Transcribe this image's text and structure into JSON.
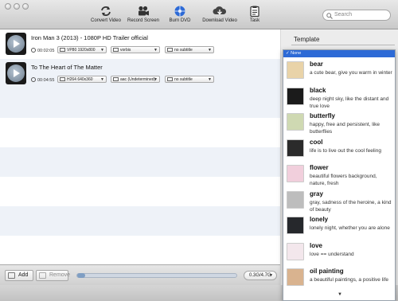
{
  "toolbar": {
    "buttons": [
      {
        "label": "Convert Video",
        "icon": "convert-icon"
      },
      {
        "label": "Record Screen",
        "icon": "camera-icon"
      },
      {
        "label": "Burn DVD",
        "icon": "dvd-icon"
      },
      {
        "label": "Download Video",
        "icon": "cloud-download-icon"
      },
      {
        "label": "Task",
        "icon": "clipboard-icon"
      }
    ],
    "search_placeholder": "Search"
  },
  "videos": [
    {
      "title": "Iron Man 3 (2013) - 1080P HD Trailer official",
      "duration": "00:02:05",
      "video_format": "VP80 1920x800",
      "audio_format": "vorbis",
      "subtitle": "no subtitle"
    },
    {
      "title": "To The Heart of The Matter",
      "duration": "00:04:55",
      "video_format": "H264 640x360",
      "audio_format": "aac (Undetermined)",
      "subtitle": "no subtitle"
    }
  ],
  "bottom": {
    "add_label": "Add",
    "remove_label": "Remove",
    "progress": 0.0,
    "capacity": "0.3G/4.7G"
  },
  "panel": {
    "template_label": "Template"
  },
  "template_dropdown": {
    "selected": "None",
    "check": "✓",
    "more_arrow": "▼",
    "items": [
      {
        "name": "bear",
        "desc": "a cute bear, give you warm in winter",
        "color": "#e9d3a8"
      },
      {
        "name": "black",
        "desc": "deep night sky, like the distant and true love",
        "color": "#1b1b1b"
      },
      {
        "name": "butterfly",
        "desc": "happy, free and persistent, like butterflies",
        "color": "#cfd9b2"
      },
      {
        "name": "cool",
        "desc": "life is to live out the cool feeling",
        "color": "#2b2b2b"
      },
      {
        "name": "flower",
        "desc": "beautiful flowers background, nature, fresh",
        "color": "#f1cfdc"
      },
      {
        "name": "gray",
        "desc": "gray,  sadness of the heroine,  a kind of beauty",
        "color": "#bdbdbd"
      },
      {
        "name": "lonely",
        "desc": "lonely night, whether you are alone",
        "color": "#26282c"
      },
      {
        "name": "love",
        "desc": "love == understand",
        "color": "#f3e7ec"
      },
      {
        "name": "oil painting",
        "desc": "a beautiful paintings, a positive life",
        "color": "#d9b38f"
      }
    ]
  },
  "colors": {
    "accent": "#2d6ad6",
    "row_alt": "#eef2f8"
  }
}
